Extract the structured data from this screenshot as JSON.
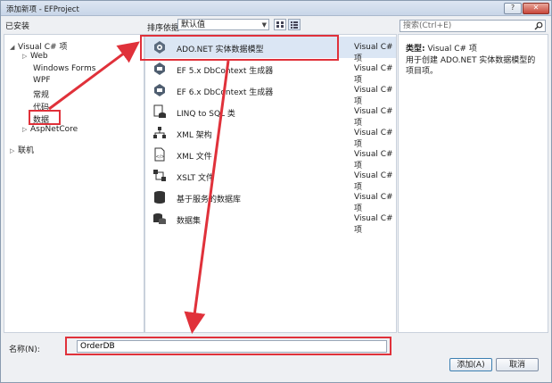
{
  "window": {
    "title": "添加新项 - EFProject",
    "help": "?",
    "close": "✕"
  },
  "toolbar": {
    "installed": "已安装",
    "sort_label": "排序依据:",
    "sort_value": "默认值",
    "search_placeholder": "搜索(Ctrl+E)"
  },
  "tree": {
    "root": "Visual C# 项",
    "children": [
      "Web",
      "Windows Forms",
      "WPF",
      "常规",
      "代码",
      "数据",
      "AspNetCore"
    ],
    "online": "联机"
  },
  "templates": [
    {
      "name": "ADO.NET 实体数据模型",
      "lang": "Visual C# 项",
      "icon": "entity-model-icon"
    },
    {
      "name": "EF 5.x DbContext 生成器",
      "lang": "Visual C# 项",
      "icon": "dbcontext-generator-icon"
    },
    {
      "name": "EF 6.x DbContext 生成器",
      "lang": "Visual C# 项",
      "icon": "dbcontext-generator-icon"
    },
    {
      "name": "LINQ to SQL 类",
      "lang": "Visual C# 项",
      "icon": "linq-sql-icon"
    },
    {
      "name": "XML 架构",
      "lang": "Visual C# 项",
      "icon": "xml-schema-icon"
    },
    {
      "name": "XML 文件",
      "lang": "Visual C# 项",
      "icon": "xml-file-icon"
    },
    {
      "name": "XSLT 文件",
      "lang": "Visual C# 项",
      "icon": "xslt-file-icon"
    },
    {
      "name": "基于服务的数据库",
      "lang": "Visual C# 项",
      "icon": "database-icon"
    },
    {
      "name": "数据集",
      "lang": "Visual C# 项",
      "icon": "dataset-icon"
    }
  ],
  "detail": {
    "type_label": "类型:",
    "type_value": "Visual C# 项",
    "description": "用于创建 ADO.NET 实体数据模型的项目项。"
  },
  "bottom": {
    "name_label": "名称(N):",
    "name_value": "OrderDB",
    "add_label": "添加(A)",
    "cancel_label": "取消"
  },
  "colors": {
    "highlight": "#e0313a",
    "selected_bg": "#dbe6f4"
  }
}
